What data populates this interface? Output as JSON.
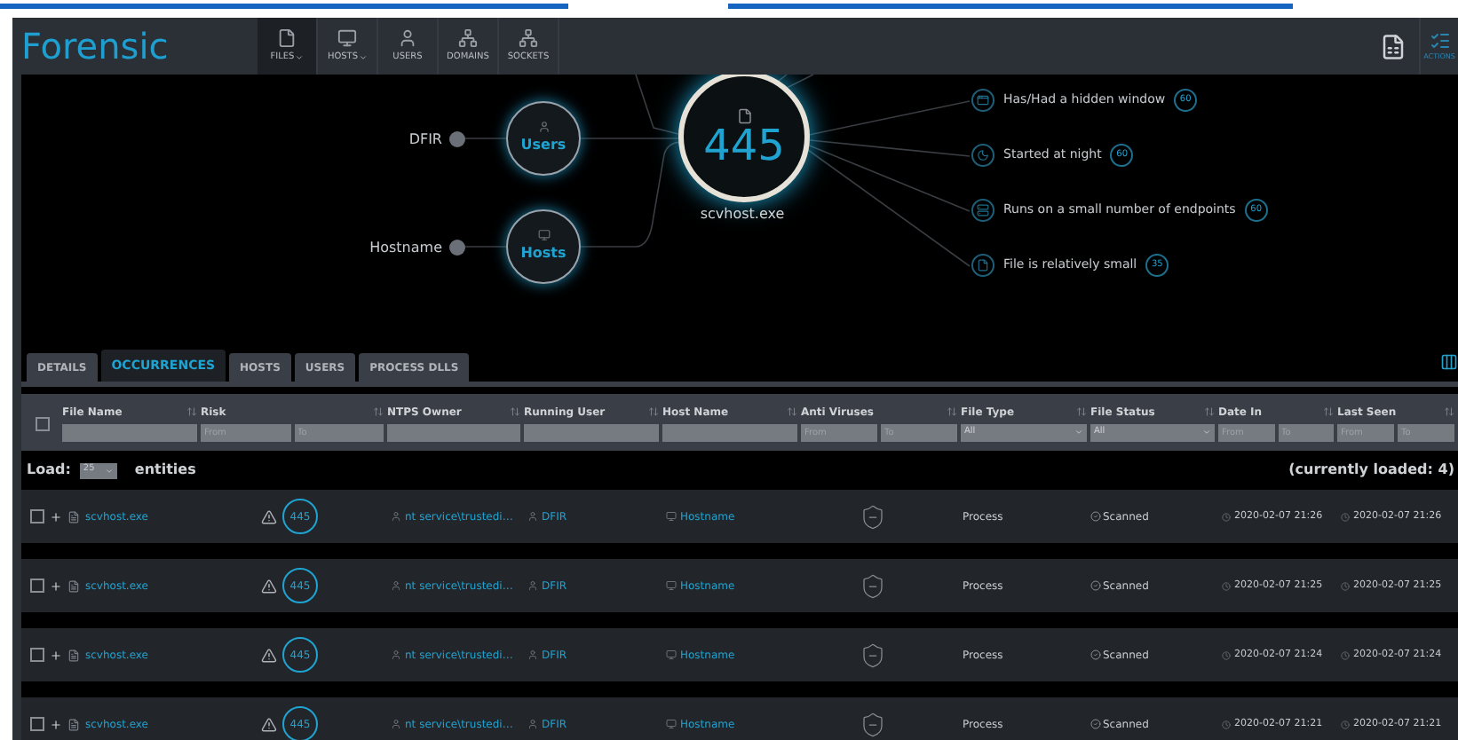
{
  "app": {
    "title": "Forensic",
    "actions_label": "ACTIONS"
  },
  "nav": [
    {
      "label": "FILES",
      "dropdown": true,
      "selected": true
    },
    {
      "label": "HOSTS",
      "dropdown": true,
      "selected": false
    },
    {
      "label": "USERS",
      "dropdown": false,
      "selected": false
    },
    {
      "label": "DOMAINS",
      "dropdown": false,
      "selected": false
    },
    {
      "label": "SOCKETS",
      "dropdown": false,
      "selected": false
    }
  ],
  "graph": {
    "center": {
      "count": "445",
      "label": "scvhost.exe"
    },
    "nodes": [
      {
        "name": "Users",
        "value": "DFIR"
      },
      {
        "name": "Hosts",
        "value": "Hostname"
      }
    ],
    "indicators": [
      {
        "text": "Has/Had a hidden window",
        "score": "60"
      },
      {
        "text": "Started at night",
        "score": "60"
      },
      {
        "text": "Runs on a small number of endpoints",
        "score": "60"
      },
      {
        "text": "File is relatively small",
        "score": "35"
      }
    ]
  },
  "tabs": [
    {
      "label": "DETAILS",
      "selected": false
    },
    {
      "label": "OCCURRENCES",
      "selected": true
    },
    {
      "label": "HOSTS",
      "selected": false
    },
    {
      "label": "USERS",
      "selected": false
    },
    {
      "label": "PROCESS DLLS",
      "selected": false
    }
  ],
  "table": {
    "select_all": {
      "checked": false
    },
    "columns": [
      {
        "label": "File Name",
        "kind": "text"
      },
      {
        "label": "Risk",
        "kind": "range",
        "fields": [
          {
            "placeholder": "From"
          },
          {
            "placeholder": "To"
          }
        ]
      },
      {
        "label": "NTPS Owner",
        "kind": "text"
      },
      {
        "label": "Running User",
        "kind": "text"
      },
      {
        "label": "Host Name",
        "kind": "text"
      },
      {
        "label": "Anti Viruses",
        "kind": "range",
        "fields": [
          {
            "placeholder": "From"
          },
          {
            "placeholder": "To"
          }
        ]
      },
      {
        "label": "File Type",
        "kind": "select",
        "value": "All"
      },
      {
        "label": "File Status",
        "kind": "select",
        "value": "All"
      },
      {
        "label": "Date In",
        "kind": "range",
        "fields": [
          {
            "placeholder": "From"
          },
          {
            "placeholder": "To"
          }
        ]
      },
      {
        "label": "Last Seen",
        "kind": "range",
        "fields": [
          {
            "placeholder": "From"
          },
          {
            "placeholder": "To"
          }
        ]
      }
    ],
    "load": {
      "label": "Load:",
      "value": "25",
      "suffix": "entities",
      "loaded": "(currently loaded: 4)"
    },
    "rows": [
      {
        "checked": false,
        "file_name": "scvhost.exe",
        "risk": "445",
        "ntfs_owner": "nt service\\trustedi…",
        "running_user": "DFIR",
        "host": "Hostname",
        "file_type": "Process",
        "status": "Scanned",
        "date_in": "2020-02-07 21:26",
        "last_seen": "2020-02-07 21:26"
      },
      {
        "checked": false,
        "file_name": "scvhost.exe",
        "risk": "445",
        "ntfs_owner": "nt service\\trustedi…",
        "running_user": "DFIR",
        "host": "Hostname",
        "file_type": "Process",
        "status": "Scanned",
        "date_in": "2020-02-07 21:25",
        "last_seen": "2020-02-07 21:25"
      },
      {
        "checked": false,
        "file_name": "scvhost.exe",
        "risk": "445",
        "ntfs_owner": "nt service\\trustedi…",
        "running_user": "DFIR",
        "host": "Hostname",
        "file_type": "Process",
        "status": "Scanned",
        "date_in": "2020-02-07 21:24",
        "last_seen": "2020-02-07 21:24"
      },
      {
        "checked": false,
        "file_name": "scvhost.exe",
        "risk": "445",
        "ntfs_owner": "nt service\\trustedi…",
        "running_user": "DFIR",
        "host": "Hostname",
        "file_type": "Process",
        "status": "Scanned",
        "date_in": "2020-02-07 21:21",
        "last_seen": "2020-02-07 21:21"
      }
    ]
  }
}
